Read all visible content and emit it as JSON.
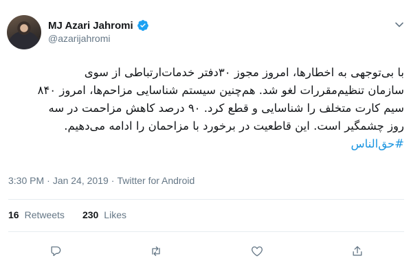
{
  "author": {
    "display_name": "MJ Azari Jahromi",
    "username": "@azarijahromi",
    "verified": true
  },
  "tweet": {
    "lines": [
      "با بی‌توجهی به اخطارها، امروز مجوز ۳۰دفتر خدمات‌ارتباطی از سوی",
      "سازمان تنظیم‌مقررات لغو شد. هم‌چنین سیستم شناسایی مزاحم‌ها، امروز ۸۴۰",
      "سیم کارت متخلف را شناسایی و قطع کرد. ۹۰ درصد کاهش مزاحمت در سه",
      "روز چشمگیر است. این قاطعیت در برخورد با مزاحمان را ادامه می‌دهیم."
    ],
    "hashtag": "#حق‌الناس"
  },
  "meta": {
    "time": "3:30 PM",
    "separator": "·",
    "date": "Jan 24, 2019",
    "source": "Twitter for Android"
  },
  "stats": {
    "retweets_count": "16",
    "retweets_label": "Retweets",
    "likes_count": "230",
    "likes_label": "Likes"
  },
  "icons": {
    "more": "chevron-down-icon",
    "reply": "reply-icon",
    "retweet": "retweet-icon",
    "like": "heart-icon",
    "share": "share-icon"
  },
  "colors": {
    "accent": "#1b95e0",
    "muted": "#657786",
    "text": "#14171a"
  }
}
